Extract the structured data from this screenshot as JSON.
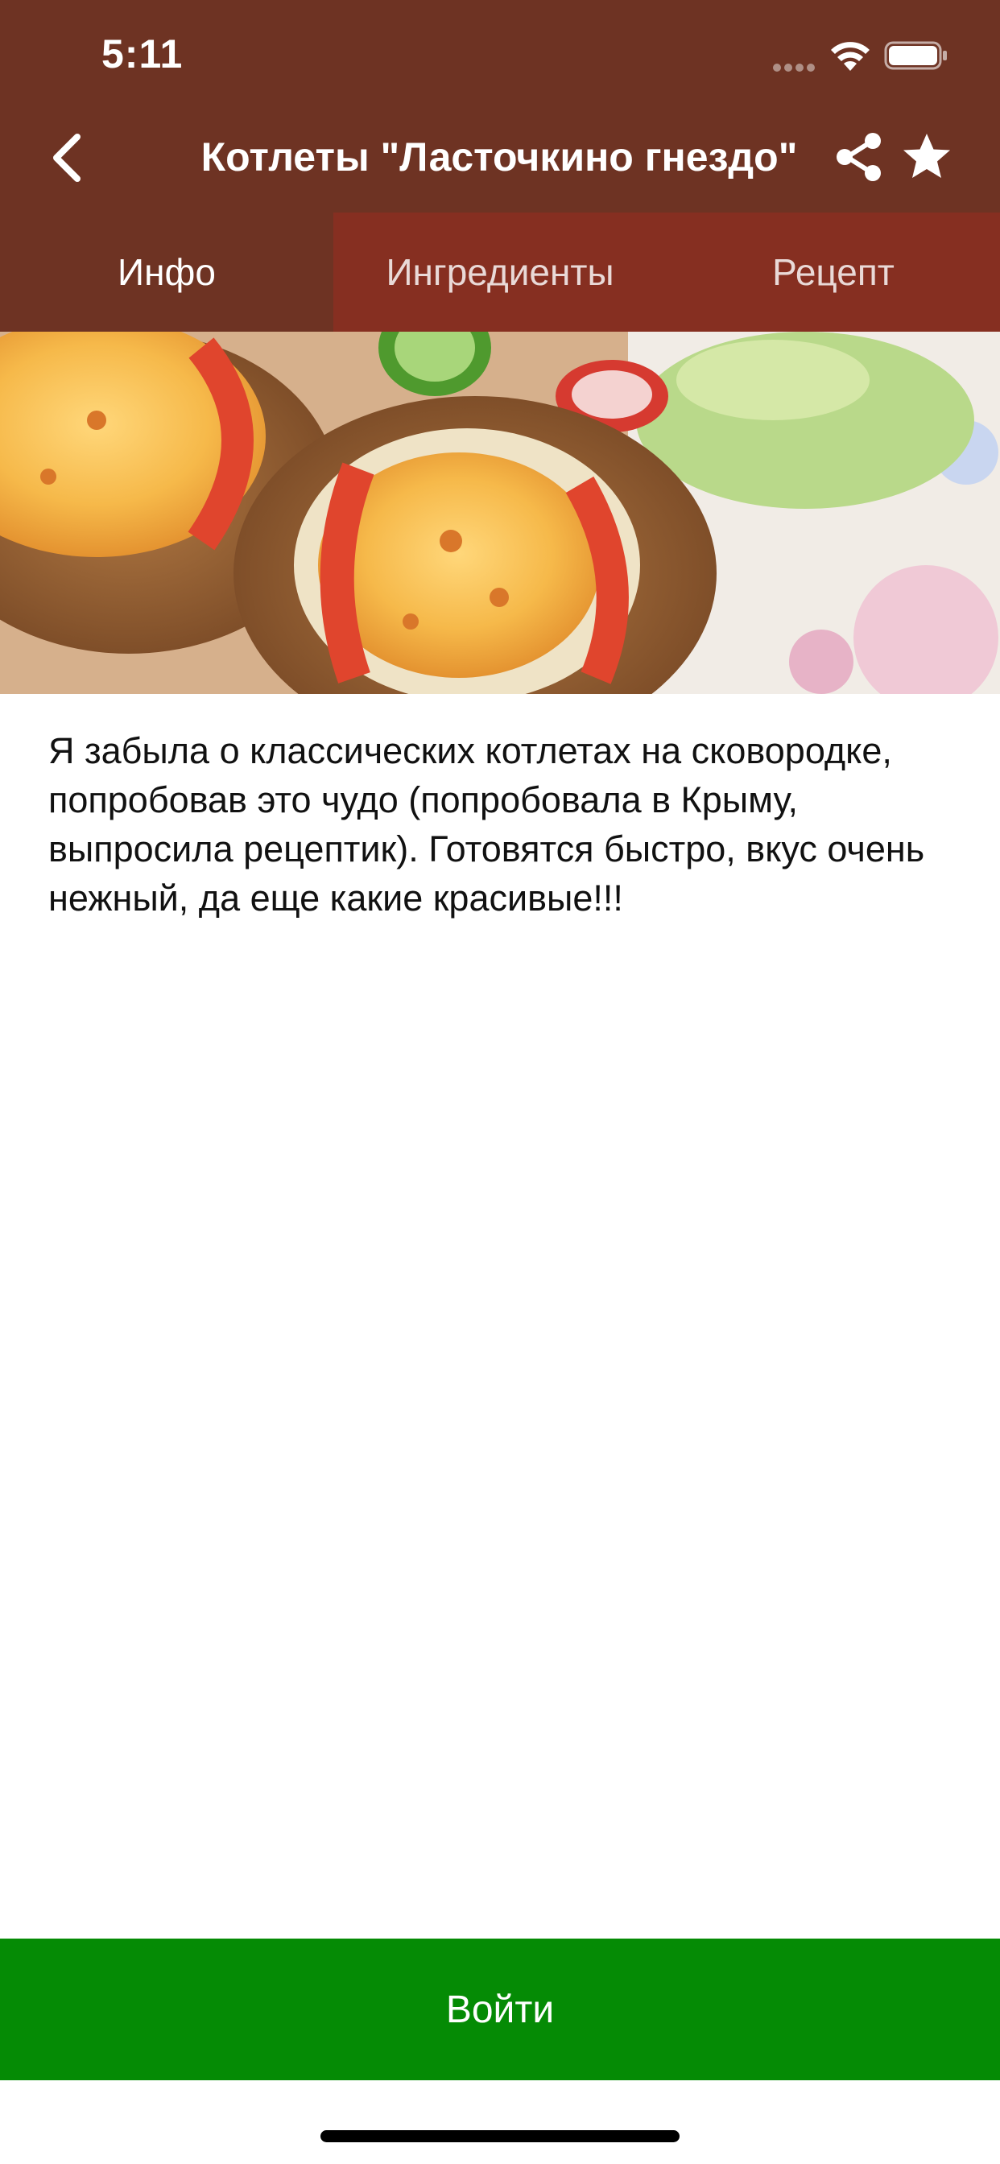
{
  "status_bar": {
    "time": "5:11"
  },
  "nav": {
    "title": "Котлеты \"Ласточкино гнездо\"",
    "back_icon": "chevron-left-icon",
    "share_icon": "share-icon",
    "favorite_icon": "star-icon"
  },
  "tabs": [
    {
      "label": "Инфо",
      "active": true
    },
    {
      "label": "Ингредиенты",
      "active": false
    },
    {
      "label": "Рецепт",
      "active": false
    }
  ],
  "description": "Я забыла о классических котлетах на сковородке, попробовав это чудо (попробовала в Крыму, выпросила рецептик). Готовятся быстро, вкус очень нежный, да еще какие красивые!!!",
  "login_button": {
    "label": "Войти"
  },
  "colors": {
    "header": "#6e3323",
    "tab_inactive": "#862f21",
    "login": "#058b05"
  }
}
